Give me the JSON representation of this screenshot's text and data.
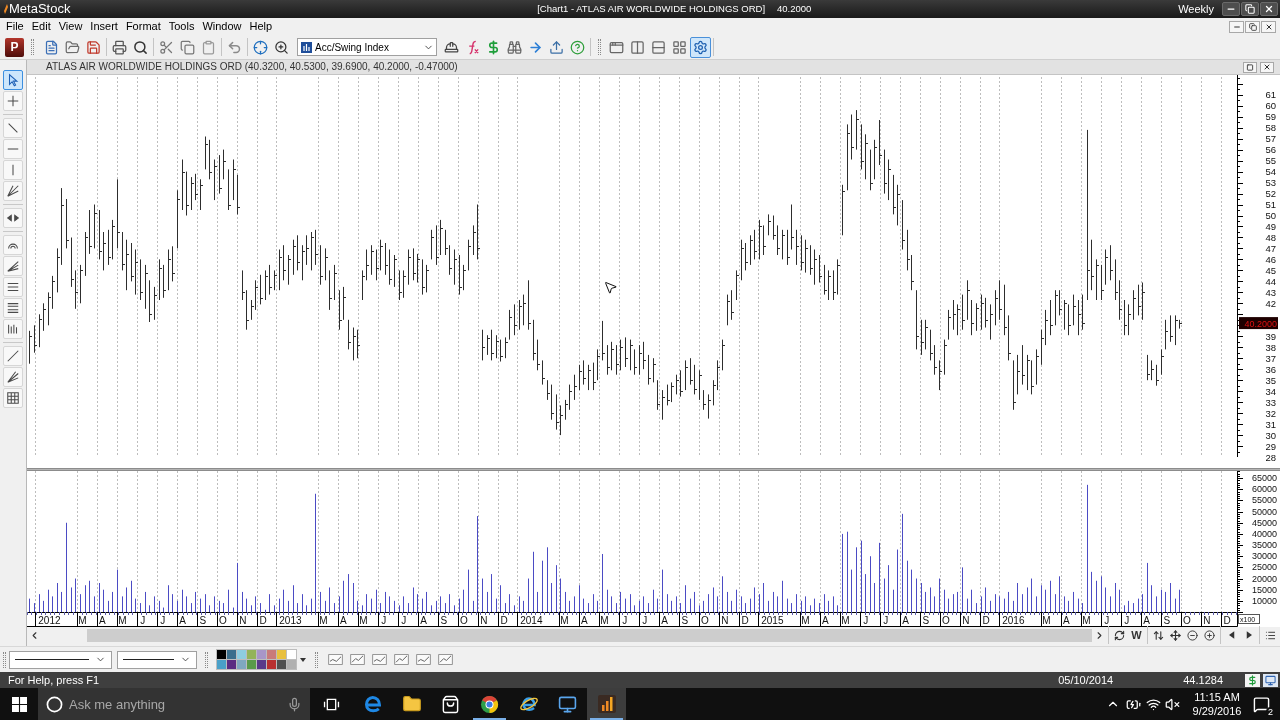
{
  "title_bar": {
    "app_name": "MetaStock",
    "document": "[Chart1 - ATLAS AIR WORLDWIDE HOLDINGS ORD]",
    "price": "40.2000",
    "periodicity": "Weekly"
  },
  "menu_bar": [
    "File",
    "Edit",
    "View",
    "Insert",
    "Format",
    "Tools",
    "Window",
    "Help"
  ],
  "toolbar": {
    "letter_button": "P",
    "indicator_select": {
      "value": "Acc/Swing Index"
    },
    "layout_buttons": [
      {
        "kind": "window",
        "selected": false
      },
      {
        "kind": "columns",
        "selected": false
      },
      {
        "kind": "rows",
        "selected": false
      },
      {
        "kind": "grid",
        "selected": false
      },
      {
        "kind": "gear",
        "selected": true
      }
    ]
  },
  "drawing_tools": [
    {
      "tools": [
        {
          "kind": "pointer",
          "selected": true
        },
        {
          "kind": "crosshair",
          "selected": false
        }
      ]
    },
    {
      "tools": [
        {
          "kind": "trendline",
          "selected": false
        },
        {
          "kind": "horizontal",
          "selected": false
        },
        {
          "kind": "vertical",
          "selected": false
        },
        {
          "kind": "speed",
          "selected": false
        }
      ]
    },
    {
      "tools": [
        {
          "kind": "arrows",
          "selected": false
        }
      ]
    },
    {
      "tools": [
        {
          "kind": "arc",
          "selected": false
        },
        {
          "kind": "fib-fan",
          "selected": false
        },
        {
          "kind": "p-lines",
          "selected": false
        },
        {
          "kind": "r-lines",
          "selected": false
        },
        {
          "kind": "bars",
          "selected": false
        }
      ]
    },
    {
      "tools": [
        {
          "kind": "line",
          "selected": false
        },
        {
          "kind": "fan",
          "selected": false
        },
        {
          "kind": "grid",
          "selected": false
        }
      ]
    }
  ],
  "chart_window": {
    "header": "ATLAS AIR WORLDWIDE HOLDINGS ORD (40.3200, 40.5300, 39.6900, 40.2000, -0.47000)",
    "price_pane": {
      "last_price": "40.2000",
      "axis_labels": [
        "61",
        "60",
        "59",
        "58",
        "57",
        "56",
        "55",
        "54",
        "53",
        "52",
        "51",
        "50",
        "49",
        "48",
        "47",
        "46",
        "45",
        "44",
        "43",
        "42",
        "39",
        "38",
        "37",
        "36",
        "35",
        "34",
        "33",
        "32",
        "31",
        "30",
        "29",
        "28"
      ]
    },
    "volume_pane": {
      "unit": "x100",
      "chart_data": {
        "type": "bar",
        "grid": true,
        "xlim": [
          2011.962,
          2016.983
        ],
        "ylim": [
          5000,
          68200
        ],
        "x": [
          2011.971,
          2011.99,
          2012.01,
          2012.029,
          2012.048,
          2012.067,
          2012.086,
          2012.105,
          2012.125,
          2012.144,
          2012.163,
          2012.182,
          2012.201,
          2012.22,
          2012.24,
          2012.259,
          2012.278,
          2012.297,
          2012.316,
          2012.335,
          2012.355,
          2012.374,
          2012.393,
          2012.412,
          2012.431,
          2012.45,
          2012.47,
          2012.489,
          2012.508,
          2012.527,
          2012.546,
          2012.565,
          2012.585,
          2012.604,
          2012.623,
          2012.642,
          2012.661,
          2012.68,
          2012.7,
          2012.719,
          2012.738,
          2012.757,
          2012.776,
          2012.795,
          2012.815,
          2012.834,
          2012.853,
          2012.872,
          2012.891,
          2012.91,
          2012.93,
          2012.949,
          2012.968,
          2012.987,
          2013.006,
          2013.025,
          2013.044,
          2013.064,
          2013.083,
          2013.102,
          2013.121,
          2013.14,
          2013.159,
          2013.179,
          2013.198,
          2013.217,
          2013.236,
          2013.255,
          2013.274,
          2013.294,
          2013.313,
          2013.332,
          2013.351,
          2013.37,
          2013.389,
          2013.409,
          2013.428,
          2013.447,
          2013.466,
          2013.485,
          2013.504,
          2013.524,
          2013.543,
          2013.562,
          2013.581,
          2013.6,
          2013.619,
          2013.639,
          2013.658,
          2013.677,
          2013.696,
          2013.715,
          2013.734,
          2013.754,
          2013.773,
          2013.792,
          2013.811,
          2013.83,
          2013.849,
          2013.869,
          2013.888,
          2013.907,
          2013.926,
          2013.945,
          2013.964,
          2013.984,
          2014.003,
          2014.022,
          2014.041,
          2014.06,
          2014.079,
          2014.098,
          2014.118,
          2014.137,
          2014.156,
          2014.175,
          2014.194,
          2014.213,
          2014.233,
          2014.252,
          2014.271,
          2014.29,
          2014.309,
          2014.328,
          2014.348,
          2014.367,
          2014.386,
          2014.405,
          2014.424,
          2014.443,
          2014.463,
          2014.482,
          2014.501,
          2014.52,
          2014.539,
          2014.558,
          2014.578,
          2014.597,
          2014.616,
          2014.635,
          2014.654,
          2014.673,
          2014.693,
          2014.712,
          2014.731,
          2014.75,
          2014.769,
          2014.788,
          2014.808,
          2014.827,
          2014.846,
          2014.865,
          2014.884,
          2014.903,
          2014.923,
          2014.942,
          2014.961,
          2014.98,
          2014.999,
          2015.018,
          2015.038,
          2015.057,
          2015.076,
          2015.095,
          2015.114,
          2015.133,
          2015.152,
          2015.172,
          2015.191,
          2015.21,
          2015.229,
          2015.248,
          2015.268,
          2015.287,
          2015.306,
          2015.325,
          2015.344,
          2015.363,
          2015.383,
          2015.402,
          2015.421,
          2015.44,
          2015.459,
          2015.478,
          2015.497,
          2015.517,
          2015.536,
          2015.555,
          2015.574,
          2015.593,
          2015.613,
          2015.632,
          2015.651,
          2015.67,
          2015.689,
          2015.708,
          2015.727,
          2015.747,
          2015.766,
          2015.785,
          2015.804,
          2015.823,
          2015.842,
          2015.862,
          2015.881,
          2015.9,
          2015.919,
          2015.938,
          2015.957,
          2015.977,
          2015.996,
          2016.015,
          2016.034,
          2016.053,
          2016.072,
          2016.092,
          2016.111,
          2016.13,
          2016.149,
          2016.168,
          2016.187,
          2016.207,
          2016.226,
          2016.245,
          2016.264,
          2016.283,
          2016.302,
          2016.322,
          2016.341,
          2016.36,
          2016.379,
          2016.398,
          2016.417,
          2016.436,
          2016.456,
          2016.475,
          2016.494,
          2016.513,
          2016.532,
          2016.551,
          2016.571,
          2016.59,
          2016.609,
          2016.628,
          2016.647,
          2016.667,
          2016.686,
          2016.705,
          2016.724,
          2016.743
        ],
        "xticks": [
          {
            "value": 2012.055,
            "label": "2012"
          },
          {
            "value": 2012.192,
            "label": "M"
          },
          {
            "value": 2012.275,
            "label": "A"
          },
          {
            "value": 2012.358,
            "label": "M"
          },
          {
            "value": 2012.442,
            "label": "J"
          },
          {
            "value": 2012.525,
            "label": "J"
          },
          {
            "value": 2012.608,
            "label": "A"
          },
          {
            "value": 2012.692,
            "label": "S"
          },
          {
            "value": 2012.775,
            "label": "O"
          },
          {
            "value": 2012.858,
            "label": "N"
          },
          {
            "value": 2012.942,
            "label": "D"
          },
          {
            "value": 2013.055,
            "label": "2013"
          },
          {
            "value": 2013.192,
            "label": "M"
          },
          {
            "value": 2013.275,
            "label": "A"
          },
          {
            "value": 2013.358,
            "label": "M"
          },
          {
            "value": 2013.442,
            "label": "J"
          },
          {
            "value": 2013.525,
            "label": "J"
          },
          {
            "value": 2013.608,
            "label": "A"
          },
          {
            "value": 2013.692,
            "label": "S"
          },
          {
            "value": 2013.775,
            "label": "O"
          },
          {
            "value": 2013.858,
            "label": "N"
          },
          {
            "value": 2013.942,
            "label": "D"
          },
          {
            "value": 2014.055,
            "label": "2014"
          },
          {
            "value": 2014.192,
            "label": "M"
          },
          {
            "value": 2014.275,
            "label": "A"
          },
          {
            "value": 2014.358,
            "label": "M"
          },
          {
            "value": 2014.442,
            "label": "J"
          },
          {
            "value": 2014.525,
            "label": "J"
          },
          {
            "value": 2014.608,
            "label": "A"
          },
          {
            "value": 2014.692,
            "label": "S"
          },
          {
            "value": 2014.775,
            "label": "O"
          },
          {
            "value": 2014.858,
            "label": "N"
          },
          {
            "value": 2014.942,
            "label": "D"
          },
          {
            "value": 2015.055,
            "label": "2015"
          },
          {
            "value": 2015.192,
            "label": "M"
          },
          {
            "value": 2015.275,
            "label": "A"
          },
          {
            "value": 2015.358,
            "label": "M"
          },
          {
            "value": 2015.442,
            "label": "J"
          },
          {
            "value": 2015.525,
            "label": "J"
          },
          {
            "value": 2015.608,
            "label": "A"
          },
          {
            "value": 2015.692,
            "label": "S"
          },
          {
            "value": 2015.775,
            "label": "O"
          },
          {
            "value": 2015.858,
            "label": "N"
          },
          {
            "value": 2015.942,
            "label": "D"
          },
          {
            "value": 2016.055,
            "label": "2016"
          },
          {
            "value": 2016.192,
            "label": "M"
          },
          {
            "value": 2016.275,
            "label": "A"
          },
          {
            "value": 2016.358,
            "label": "M"
          },
          {
            "value": 2016.442,
            "label": "J"
          },
          {
            "value": 2016.525,
            "label": "J"
          },
          {
            "value": 2016.608,
            "label": "A"
          },
          {
            "value": 2016.692,
            "label": "S"
          },
          {
            "value": 2016.775,
            "label": "O"
          },
          {
            "value": 2016.858,
            "label": "N"
          },
          {
            "value": 2016.942,
            "label": "D"
          }
        ],
        "yticks": [
          10000,
          15000,
          20000,
          25000,
          30000,
          35000,
          40000,
          45000,
          50000,
          55000,
          60000,
          65000
        ],
        "series": [
          {
            "color": "#4b4bc4",
            "values": [
              11000,
              9000,
              13000,
              10000,
              15000,
              12000,
              18000,
              14000,
              45000,
              16000,
              20000,
              13000,
              17000,
              19000,
              12000,
              18000,
              15000,
              10000,
              14000,
              24000,
              12000,
              16000,
              19000,
              11000,
              9000,
              14000,
              8000,
              12000,
              10000,
              7000,
              17000,
              13000,
              10000,
              15000,
              12000,
              9000,
              14000,
              11000,
              13000,
              8000,
              12000,
              10000,
              9000,
              15000,
              7000,
              27000,
              14000,
              11000,
              8000,
              12000,
              9000,
              6000,
              13000,
              8000,
              11000,
              15000,
              10000,
              17000,
              9000,
              13000,
              8000,
              11000,
              58000,
              14000,
              10000,
              16000,
              9000,
              12000,
              19000,
              22000,
              18000,
              10000,
              8000,
              13000,
              11000,
              15000,
              9000,
              14000,
              12000,
              10000,
              8000,
              12000,
              9000,
              16000,
              13000,
              11000,
              14000,
              8000,
              10000,
              12000,
              9000,
              13000,
              8000,
              11000,
              15000,
              24000,
              10000,
              48000,
              20000,
              14000,
              22000,
              11000,
              17000,
              9000,
              13000,
              8000,
              12000,
              10000,
              20000,
              32000,
              14000,
              28000,
              34000,
              18000,
              26000,
              20000,
              14000,
              10000,
              12000,
              17000,
              11000,
              9000,
              13000,
              10000,
              31000,
              15000,
              12000,
              9000,
              14000,
              11000,
              13000,
              8000,
              10000,
              12000,
              9000,
              15000,
              11000,
              24000,
              13000,
              10000,
              12000,
              9000,
              17000,
              11000,
              14000,
              8000,
              10000,
              13000,
              16000,
              12000,
              21000,
              14000,
              10000,
              15000,
              12000,
              9000,
              11000,
              16000,
              13000,
              18000,
              10000,
              14000,
              12000,
              19000,
              11000,
              9000,
              13000,
              10000,
              12000,
              8000,
              11000,
              9000,
              13000,
              10000,
              12000,
              8000,
              40000,
              41000,
              24000,
              34000,
              37000,
              22000,
              30000,
              18000,
              36000,
              20000,
              26000,
              15000,
              33000,
              49000,
              28000,
              24000,
              20000,
              18000,
              14000,
              16000,
              12000,
              20000,
              15000,
              11000,
              13000,
              14000,
              25000,
              11000,
              15000,
              9000,
              12000,
              16000,
              10000,
              13000,
              12000,
              11000,
              14000,
              10000,
              18000,
              13000,
              16000,
              20000,
              12000,
              17000,
              15000,
              19000,
              13000,
              21000,
              12000,
              10000,
              14000,
              11000,
              9000,
              62000,
              23000,
              19000,
              21000,
              16000,
              12000,
              18000,
              15000,
              8000,
              10000,
              9000,
              11000,
              13000,
              27000,
              17000,
              12000,
              15000,
              14000,
              18000,
              11000,
              15000
            ]
          }
        ]
      }
    },
    "scroll_bar": {
      "periodicity_button": "W"
    }
  },
  "format_bar": {
    "palette": [
      {
        "color": "#000000"
      },
      {
        "color": "#3a6e8c"
      },
      {
        "color": "#8ecde0"
      },
      {
        "color": "#93b35a"
      },
      {
        "color": "#a896c8"
      },
      {
        "color": "#c97a7a"
      },
      {
        "color": "#e8c040"
      },
      {
        "color": "#ffffff"
      },
      {
        "color": "#4aa0c8"
      },
      {
        "color": "#5a2d82"
      },
      {
        "color": "#7fa8c0"
      },
      {
        "color": "#5a9a4a"
      },
      {
        "color": "#5a3a8a"
      },
      {
        "color": "#b83030"
      },
      {
        "color": "#505050"
      },
      {
        "color": "#b0b0b0"
      }
    ]
  },
  "status_bar": {
    "help": "For Help, press F1",
    "date": "05/10/2014",
    "value": "44.1284"
  },
  "taskbar": {
    "search": {
      "placeholder": "Ask me anything"
    },
    "apps": [
      {
        "kind": "e-browser",
        "running": false,
        "selected": false
      },
      {
        "kind": "folder",
        "running": false,
        "selected": false
      },
      {
        "kind": "bag",
        "running": false,
        "selected": false
      },
      {
        "kind": "round-browser",
        "running": true,
        "selected": false
      },
      {
        "kind": "e-globe",
        "running": false,
        "selected": false
      },
      {
        "kind": "computer",
        "running": false,
        "selected": false
      },
      {
        "kind": "chart-app",
        "running": true,
        "selected": true
      }
    ],
    "volume_muted": true,
    "time": "11:15 AM",
    "date": "9/29/2016",
    "notification_count": "2"
  }
}
